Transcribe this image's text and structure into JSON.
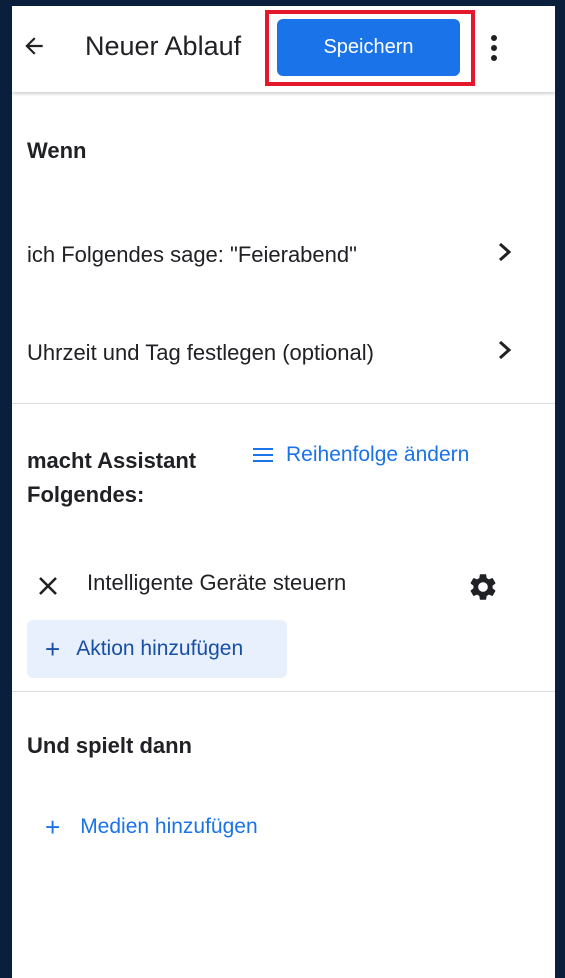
{
  "header": {
    "title": "Neuer Ablauf",
    "save_label": "Speichern",
    "back_icon": "arrow-left-icon",
    "more_icon": "more-vert-icon"
  },
  "when": {
    "heading": "Wenn",
    "items": [
      {
        "label": "ich Folgendes sage: \"Feierabend\""
      },
      {
        "label": "Uhrzeit und Tag festlegen (optional)"
      }
    ]
  },
  "actions": {
    "heading_line1": "macht Assistant",
    "heading_line2": "Folgendes:",
    "reorder_label": "Reihenfolge ändern",
    "items": [
      {
        "label": "Intelligente Geräte steuern"
      }
    ],
    "add_label": "Aktion hinzufügen"
  },
  "media": {
    "heading": "Und spielt dann",
    "add_label": "Medien hinzufügen"
  },
  "colors": {
    "accent": "#1a73e8",
    "highlight": "#e3192b",
    "background": "#0a1f3c"
  }
}
